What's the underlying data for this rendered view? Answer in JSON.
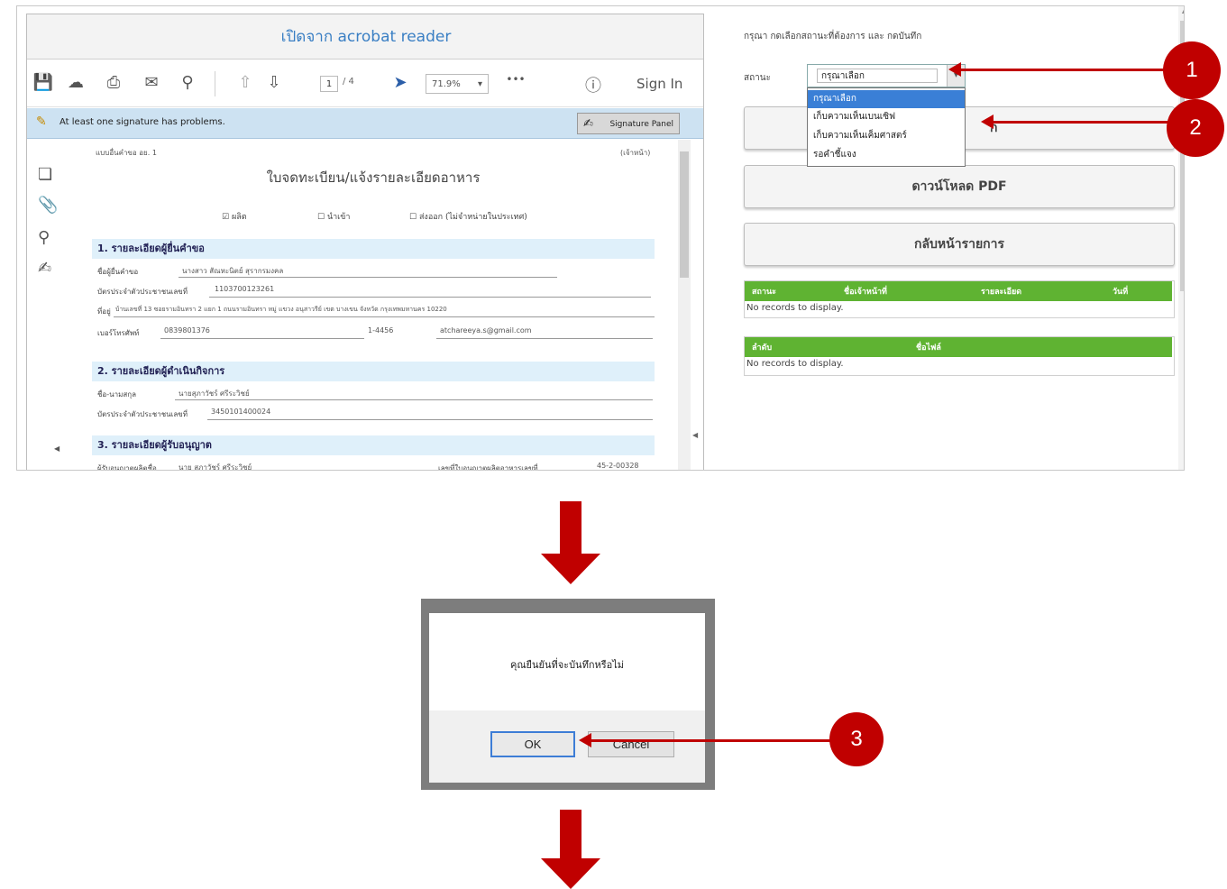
{
  "reader": {
    "header_title": "เปิดจาก acrobat reader",
    "page_current": "1",
    "page_total": "/ 4",
    "zoom": "71.9%",
    "sign_in": "Sign In",
    "signature_warning": "At least one signature has problems.",
    "signature_panel": "Signature Panel"
  },
  "document": {
    "form_code": "แบบอื่นคำขอ อย. 1",
    "corner_note": "(เจ้าหน้า)",
    "title": "ใบจดทะเบียน/แจ้งรายละเอียดอาหาร",
    "options": [
      "ผลิต",
      "นำเข้า",
      "ส่งออก (ไม่จำหน่ายในประเทศ)"
    ],
    "section1": "1. รายละเอียดผู้ยื่นคำขอ",
    "section2": "2. รายละเอียดผู้ดำเนินกิจการ",
    "section3": "3. รายละเอียดผู้รับอนุญาต",
    "fields": {
      "applicant_label": "ชื่อผู้ยื่นคำขอ",
      "applicant_value": "นางสาว สัณหะนิตย์ สุรากรมงคล",
      "id_label": "บัตรประจำตัวประชาชนเลขที่",
      "id_value": "1103700123261",
      "address_label": "ที่อยู่",
      "address_value": "บ้านเลขที่ 13  ซอยรามอินทรา 2 แยก 1 ถนนรามอินทรา หมู่ แขวง อนุสาวรีย์ เขต บางเขน จังหวัด กรุงเทพมหานคร 10220",
      "phone_label": "เบอร์โทรศัพท์",
      "phone_value": "0839801376",
      "fax_value": "1-4456",
      "email_value": "atchareeya.s@gmail.com",
      "operator_label": "ชื่อ-นามสกุล",
      "operator_value": "นายสุภาวัชร์ ศรีระวิชย์",
      "operator_id_label": "บัตรประจำตัวประชาชนเลขที่",
      "operator_id_value": "3450101400024",
      "licensee_label": "ผู้รับอนุญาตผลิตชื่อ",
      "licensee_value": "นาย สุภาวัชร์ ศรีระวิชย์",
      "license_no_label": "เลขที่ใบอนุญาตผลิตอาหารเลขที่",
      "license_no_value": "45-2-00328"
    }
  },
  "form": {
    "instruction": "กรุณา กดเลือกสถานะที่ต้องการ และ กดบันทึก",
    "status_label": "สถานะ",
    "status_selected": "กรุณาเลือก",
    "status_options": [
      "กรุณาเลือก",
      "เก็บความเห็นเบนเซิฟ",
      "เก็บความเห็นเค็มศาสตร์",
      "รอคำชี้แจง"
    ],
    "save_button_tail": "ก",
    "pdf_button": "ดาวน์โหลด PDF",
    "back_button": "กลับหน้ารายการ",
    "grid1_headers": [
      "สถานะ",
      "ชื่อเจ้าหน้าที่",
      "รายละเอียด",
      "วันที่"
    ],
    "grid2_headers": [
      "ลำดับ",
      "ชื่อไฟล์"
    ],
    "no_records": "No records to display."
  },
  "callouts": [
    "1",
    "2",
    "3"
  ],
  "dialog": {
    "message": "คุณยืนยันที่จะบันทึกหรือไม่",
    "ok": "OK",
    "cancel": "Cancel"
  },
  "colors": {
    "callout_red": "#c00000",
    "grid_green": "#5fb332",
    "link_blue": "#3a7fc4"
  }
}
